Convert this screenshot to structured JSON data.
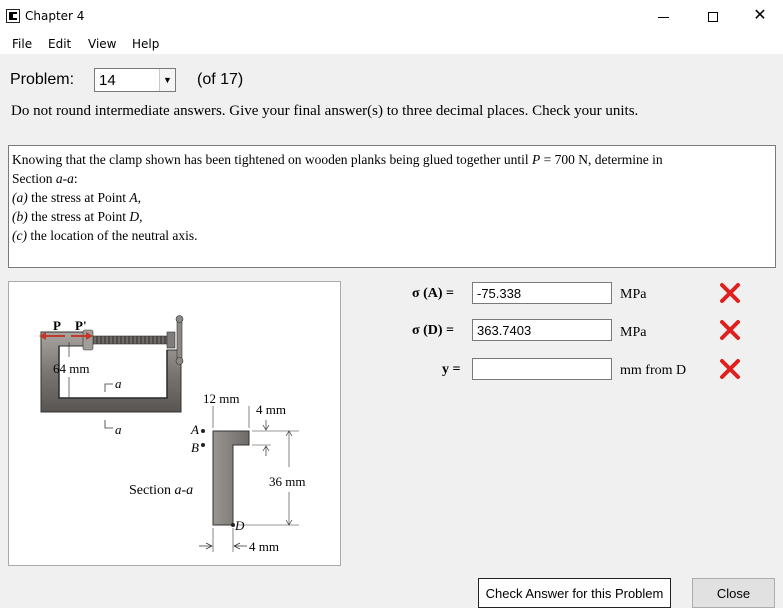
{
  "window": {
    "title": "Chapter 4",
    "minimize_icon": "minimize-icon",
    "maximize_icon": "maximize-icon",
    "close_glyph": "✕"
  },
  "menu": {
    "items": [
      "File",
      "Edit",
      "View",
      "Help"
    ]
  },
  "problem": {
    "label": "Problem:",
    "selected": "14",
    "of_text": "(of 17)"
  },
  "instructions": "Do not round intermediate answers.  Give your final answer(s) to three decimal places.  Check your units.",
  "statement": {
    "line1_before_P": "Knowing that the clamp shown has been tightened on wooden planks being glued together until ",
    "line1_P": "P",
    "line1_after_P": " = 700 N, determine in",
    "line2_prefix": "Section ",
    "line2_section": "a-a",
    "line2_suffix": ":",
    "parts": [
      {
        "letter": "(a)",
        "before": " the stress at Point ",
        "point": "A",
        "after": ","
      },
      {
        "letter": "(b)",
        "before": " the stress at Point ",
        "point": "D",
        "after": ","
      },
      {
        "letter": "(c)",
        "before": " the location of the neutral axis.",
        "point": "",
        "after": ""
      }
    ]
  },
  "figure": {
    "force_P": "P",
    "force_P_prime": "P'",
    "dim_64": "64 mm",
    "label_a": "a",
    "label_A": "A",
    "label_B": "B",
    "label_D": "D",
    "dim_12": "12 mm",
    "dim_4_top": "4 mm",
    "dim_36": "36 mm",
    "dim_4_bottom": "4 mm",
    "section_prefix": "Section ",
    "section_label": "a-a"
  },
  "answers": [
    {
      "label": "σ (A) =",
      "value": "-75.338",
      "unit": "MPa",
      "status": "incorrect"
    },
    {
      "label": "σ (D) =",
      "value": "363.7403",
      "unit": "MPa",
      "status": "incorrect"
    },
    {
      "label": "y =",
      "value": "",
      "unit": "mm from D",
      "status": "incorrect"
    }
  ],
  "buttons": {
    "check": "Check Answer for this Problem",
    "close": "Close"
  },
  "colors": {
    "incorrect": "#e0201e",
    "clamp": "#8a8682",
    "section": "#8c8885"
  }
}
